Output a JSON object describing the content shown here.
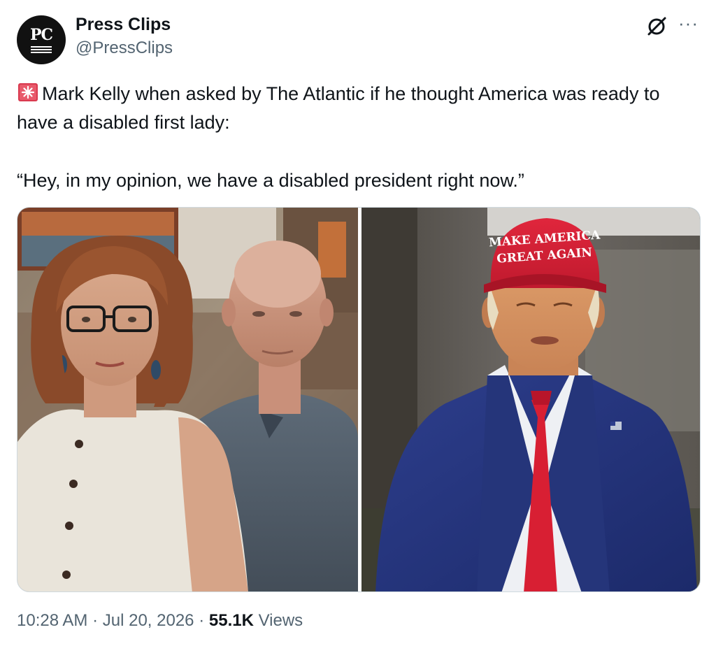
{
  "author": {
    "avatar_text": "PC",
    "display_name": "Press Clips",
    "handle": "@PressClips"
  },
  "icons": {
    "grok": "grok-icon",
    "more": "more-icon",
    "siren": "rotating-light-emoji"
  },
  "tweet": {
    "text": "Mark Kelly when asked by The Atlantic if he thought America was ready to have a disabled first lady:",
    "quote": "“Hey, in my opinion, we have a disabled president right now.”"
  },
  "media": {
    "left_image": "photo-couple",
    "right_image": "photo-man-red-cap",
    "cap_text_line1": "MAKE AMERICA",
    "cap_text_line2": "GREAT AGAIN"
  },
  "meta": {
    "time": "10:28 AM",
    "separator": "·",
    "date": "Jul 20, 2026",
    "views_count": "55.1K",
    "views_label": "Views"
  },
  "colors": {
    "text": "#0f1419",
    "secondary": "#536471",
    "border": "#cfd9de"
  }
}
